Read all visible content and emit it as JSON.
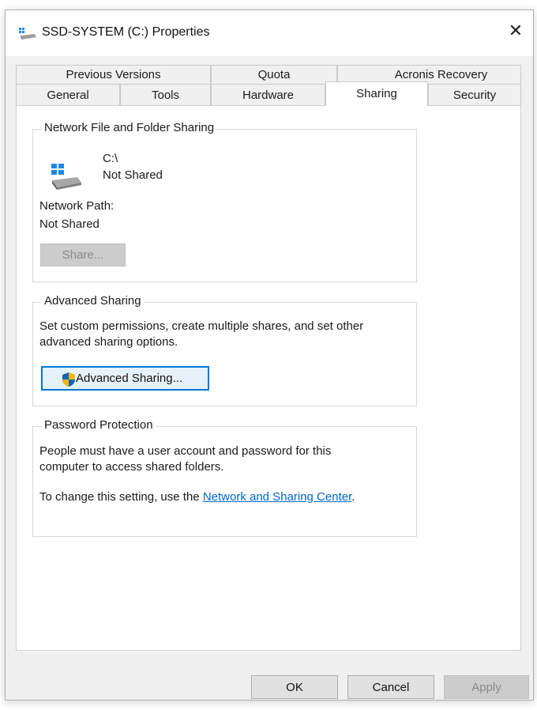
{
  "window": {
    "title": "SSD-SYSTEM (C:) Properties",
    "close_label": "✕"
  },
  "tabs": {
    "row1": [
      {
        "label": "Previous Versions"
      },
      {
        "label": "Quota"
      },
      {
        "label": "Acronis Recovery"
      }
    ],
    "row2": [
      {
        "label": "General"
      },
      {
        "label": "Tools"
      },
      {
        "label": "Hardware"
      },
      {
        "label": "Sharing",
        "active": true
      },
      {
        "label": "Security"
      }
    ]
  },
  "network_sharing": {
    "group_title": "Network File and Folder Sharing",
    "drive_label": "C:\\",
    "drive_status": "Not Shared",
    "network_path_label": "Network Path:",
    "network_path_value": "Not Shared",
    "share_button": "Share..."
  },
  "advanced_sharing": {
    "group_title": "Advanced Sharing",
    "description_line1": "Set custom permissions, create multiple shares, and set other",
    "description_line2": "advanced sharing options.",
    "button_label": "Advanced Sharing..."
  },
  "password_protection": {
    "group_title": "Password Protection",
    "description_line1": "People must have a user account and password for this",
    "description_line2": "computer to access shared folders.",
    "change_prefix": "To change this setting, use the ",
    "link_text": "Network and Sharing Center",
    "change_suffix": "."
  },
  "footer": {
    "ok": "OK",
    "cancel": "Cancel",
    "apply": "Apply"
  },
  "colors": {
    "accent": "#0078d7",
    "link": "#0066cc",
    "dialog_bg": "#f0f0f0"
  }
}
